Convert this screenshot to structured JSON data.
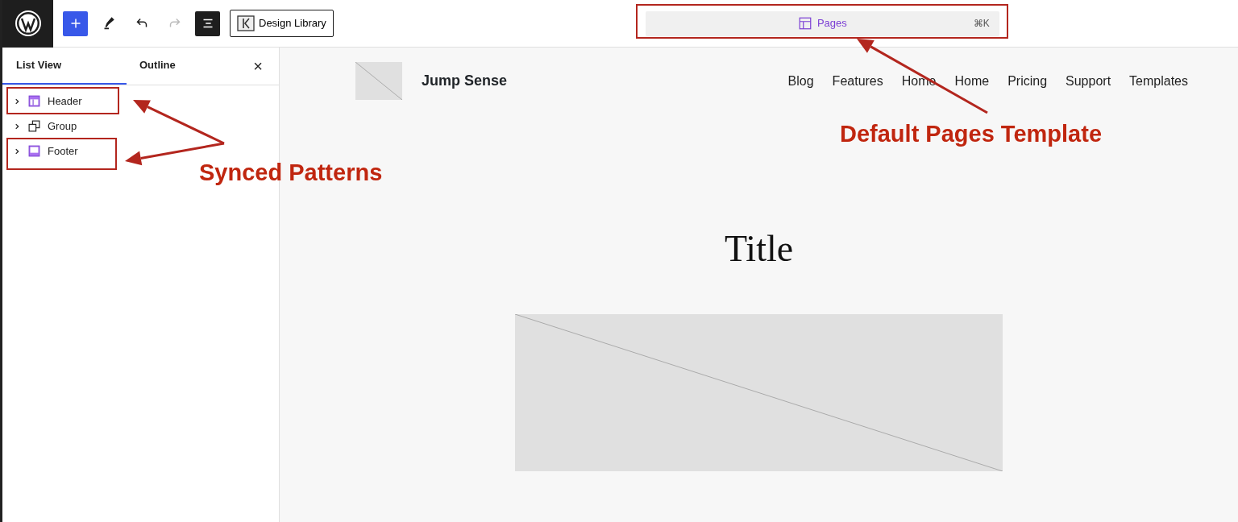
{
  "toolbar": {
    "tools": [
      {
        "kind": "add",
        "disabled": false,
        "selected": true
      },
      {
        "kind": "pencil",
        "disabled": false,
        "selected": false
      },
      {
        "kind": "undo",
        "disabled": false,
        "selected": false
      },
      {
        "kind": "redo",
        "disabled": true,
        "selected": false
      },
      {
        "kind": "listview",
        "disabled": false,
        "selected": true
      }
    ],
    "design_library": "Design Library"
  },
  "command_bar": {
    "label": "Pages",
    "shortcut": "⌘K"
  },
  "sidebar": {
    "tabs": [
      {
        "label": "List View",
        "selected": true
      },
      {
        "label": "Outline",
        "selected": false
      }
    ],
    "close": "×",
    "items": [
      {
        "label": "Header",
        "kind": "header",
        "expanded": false
      },
      {
        "label": "Group",
        "kind": "group",
        "expanded": false
      },
      {
        "label": "Footer",
        "kind": "footer",
        "expanded": false
      }
    ]
  },
  "canvas": {
    "site_title": "Jump Sense",
    "nav": [
      "Blog",
      "Features",
      "Home",
      "Home",
      "Pricing",
      "Support",
      "Templates"
    ],
    "page_title": "Title"
  },
  "annotations": [
    {
      "text": "Synced Patterns"
    },
    {
      "text": "Default Pages Template"
    }
  ]
}
